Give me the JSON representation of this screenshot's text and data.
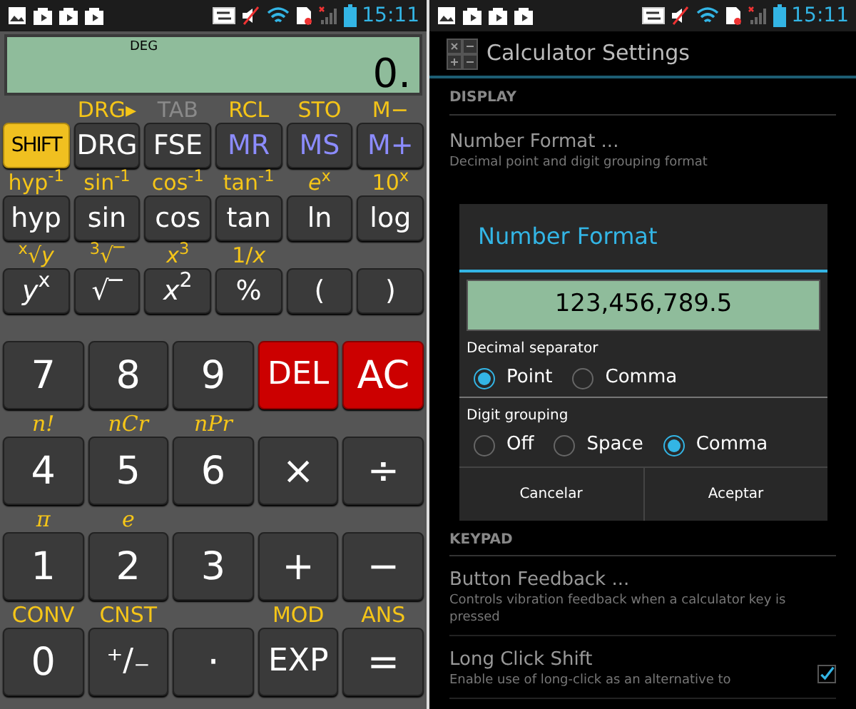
{
  "calculator": {
    "status_bar": {
      "time": "15:11"
    },
    "display": {
      "mode": "DEG",
      "value": "0."
    },
    "top_rows": [
      {
        "keys": [
          {
            "label": "SHIFT",
            "kind": "shift"
          },
          {
            "label": "DRG",
            "kind": "normal",
            "alt": {
              "text": "DRG▸",
              "disabled": false,
              "italic": false
            }
          },
          {
            "label": "FSE",
            "kind": "normal",
            "alt": {
              "text": "TAB",
              "disabled": true,
              "italic": false
            }
          },
          {
            "label": "MR",
            "kind": "memory",
            "alt": {
              "text": "RCL",
              "disabled": false,
              "italic": false
            }
          },
          {
            "label": "MS",
            "kind": "memory",
            "alt": {
              "text": "STO",
              "disabled": false,
              "italic": false
            }
          },
          {
            "label": "M+",
            "kind": "memory",
            "alt": {
              "text": "M−",
              "disabled": false,
              "italic": false
            }
          }
        ]
      },
      {
        "keys": [
          {
            "label": "hyp",
            "kind": "normal",
            "alt": {
              "text": "hyp$^{-1}$",
              "disabled": false,
              "italic": false
            }
          },
          {
            "label": "sin",
            "kind": "normal",
            "alt": {
              "text": "sin$^{-1}$",
              "disabled": false,
              "italic": false
            }
          },
          {
            "label": "cos",
            "kind": "normal",
            "alt": {
              "text": "cos$^{-1}$",
              "disabled": false,
              "italic": false
            }
          },
          {
            "label": "tan",
            "kind": "normal",
            "alt": {
              "text": "tan$^{-1}$",
              "disabled": false,
              "italic": false
            }
          },
          {
            "label": "ln",
            "kind": "normal",
            "alt": {
              "text": "*e*$^{x}$",
              "disabled": false,
              "italic": false
            }
          },
          {
            "label": "log",
            "kind": "normal",
            "alt": {
              "text": "10$^{x}$",
              "disabled": false,
              "italic": false
            }
          }
        ]
      },
      {
        "keys": [
          {
            "label": "*y*$^{x}$",
            "kind": "normal",
            "alt": {
              "text": "$^{x}$√*y*",
              "disabled": false,
              "italic": false
            }
          },
          {
            "label": "√‾",
            "kind": "normal",
            "alt": {
              "text": "$^{3}$√‾",
              "disabled": false,
              "italic": false
            }
          },
          {
            "label": "*x*$^{2}$",
            "kind": "normal",
            "alt": {
              "text": "*x*$^{3}$",
              "disabled": false,
              "italic": false
            }
          },
          {
            "label": "%",
            "kind": "normal",
            "alt": {
              "text": "1/*x*",
              "disabled": false,
              "italic": false
            }
          },
          {
            "label": "(",
            "kind": "normal"
          },
          {
            "label": ")",
            "kind": "normal"
          }
        ]
      }
    ],
    "bottom_rows": [
      {
        "keys": [
          {
            "label": "7",
            "kind": "normal"
          },
          {
            "label": "8",
            "kind": "normal"
          },
          {
            "label": "9",
            "kind": "normal"
          },
          {
            "label": "DEL",
            "kind": "red"
          },
          {
            "label": "AC",
            "kind": "red"
          }
        ]
      },
      {
        "keys": [
          {
            "label": "4",
            "kind": "normal",
            "alt": {
              "text": "n!",
              "disabled": false,
              "italic": true
            }
          },
          {
            "label": "5",
            "kind": "normal",
            "alt": {
              "text": "nCr",
              "disabled": false,
              "italic": true
            }
          },
          {
            "label": "6",
            "kind": "normal",
            "alt": {
              "text": "nPr",
              "disabled": false,
              "italic": true
            }
          },
          {
            "label": "×",
            "kind": "normal"
          },
          {
            "label": "÷",
            "kind": "normal"
          }
        ]
      },
      {
        "keys": [
          {
            "label": "1",
            "kind": "normal",
            "alt": {
              "text": "π",
              "disabled": false,
              "italic": true
            }
          },
          {
            "label": "2",
            "kind": "normal",
            "alt": {
              "text": "e",
              "disabled": false,
              "italic": true
            }
          },
          {
            "label": "3",
            "kind": "normal"
          },
          {
            "label": "+",
            "kind": "normal"
          },
          {
            "label": "−",
            "kind": "normal"
          }
        ]
      },
      {
        "keys": [
          {
            "label": "0",
            "kind": "normal",
            "alt": {
              "text": "CONV",
              "disabled": false,
              "italic": false
            }
          },
          {
            "label": "⁺∕₋",
            "kind": "normal",
            "alt": {
              "text": "CNST",
              "disabled": false,
              "italic": false
            }
          },
          {
            "label": "·",
            "kind": "normal"
          },
          {
            "label": "EXP",
            "kind": "normal",
            "alt": {
              "text": "MOD",
              "disabled": false,
              "italic": false
            }
          },
          {
            "label": "=",
            "kind": "normal",
            "alt": {
              "text": "ANS",
              "disabled": false,
              "italic": false
            }
          }
        ]
      }
    ]
  },
  "settings": {
    "status_bar": {
      "time": "15:11"
    },
    "title": "Calculator Settings",
    "display_section": {
      "header": "DISPLAY",
      "item": {
        "title": "Number Format ...",
        "summary": "Decimal point and digit grouping format"
      }
    },
    "keypad_section": {
      "header": "KEYPAD",
      "items": [
        {
          "title": "Button Feedback ...",
          "summary": "Controls vibration feedback when a calculator key is pressed"
        },
        {
          "title": "Long Click Shift",
          "summary": "Enable use of long-click as an alternative to",
          "checked": true
        }
      ]
    },
    "dialog": {
      "title": "Number Format",
      "preview": "123,456,789.5",
      "groups": [
        {
          "label": "Decimal separator",
          "options": [
            {
              "label": "Point",
              "selected": true
            },
            {
              "label": "Comma",
              "selected": false
            }
          ]
        },
        {
          "label": "Digit grouping",
          "options": [
            {
              "label": "Off",
              "selected": false
            },
            {
              "label": "Space",
              "selected": false
            },
            {
              "label": "Comma",
              "selected": true
            }
          ]
        }
      ],
      "buttons": [
        "Cancelar",
        "Aceptar"
      ]
    }
  }
}
